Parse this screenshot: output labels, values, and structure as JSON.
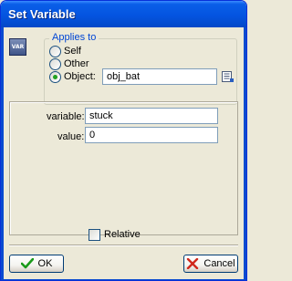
{
  "window": {
    "title": "Set Variable"
  },
  "icon": {
    "name": "var-icon",
    "text": "VAR"
  },
  "applies_to": {
    "label": "Applies to",
    "options": [
      "Self",
      "Other",
      "Object:"
    ],
    "selected": "Object:",
    "object_value": "obj_bat",
    "browse_icon": "object-browse-icon"
  },
  "fields": {
    "variable_label": "variable:",
    "variable_value": "stuck",
    "value_label": "value:",
    "value_value": "0"
  },
  "relative": {
    "label": "Relative",
    "checked": false
  },
  "buttons": {
    "ok_label": "OK",
    "cancel_label": "Cancel"
  },
  "colors": {
    "title_bar": "#0454e0",
    "ok_check": "#1a9a1a",
    "cancel_x": "#d0281c",
    "group_label": "#0046d5"
  }
}
